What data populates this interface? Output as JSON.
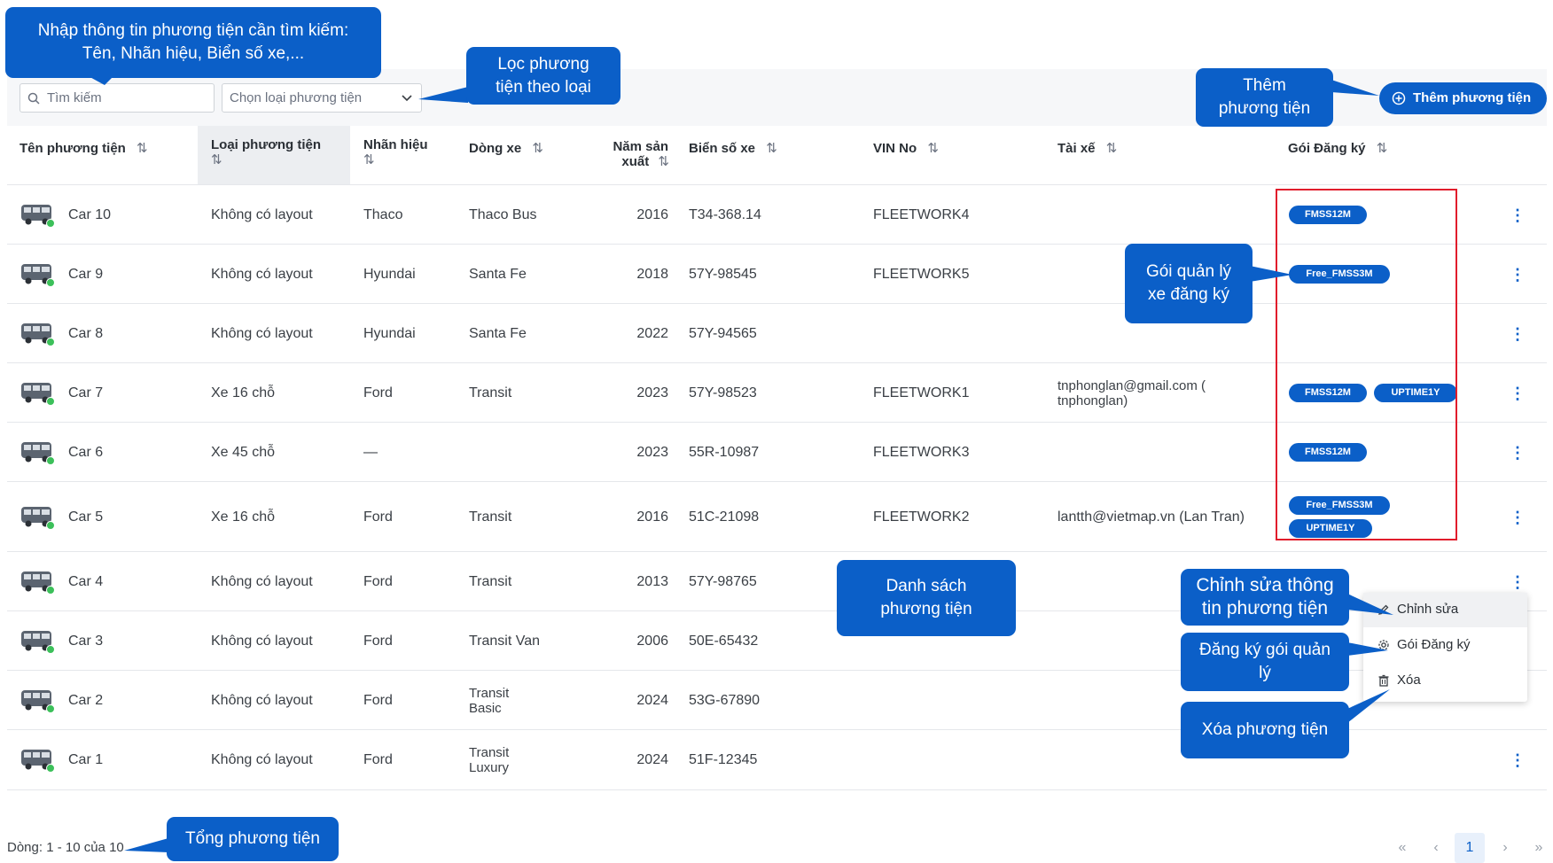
{
  "toolbar": {
    "search_placeholder": "Tìm kiếm",
    "type_select_placeholder": "Chọn loại phương tiện",
    "add_button_label": "Thêm phương tiện"
  },
  "columns": {
    "name": "Tên phương tiện",
    "type": "Loại phương tiện",
    "brand": "Nhãn hiệu",
    "model": "Dòng xe",
    "year_line1": "Năm sản",
    "year_line2": "xuất",
    "plate": "Biển số xe",
    "vin": "VIN No",
    "driver": "Tài xế",
    "package": "Gói Đăng ký",
    "sort_icon": "⇅"
  },
  "rows": [
    {
      "name": "Car 10",
      "type": "Không có layout",
      "brand": "Thaco",
      "model": "Thaco Bus",
      "year": "2016",
      "plate": "T34-368.14",
      "vin": "FLEETWORK4",
      "driver": "",
      "packages": [
        "FMSS12M"
      ]
    },
    {
      "name": "Car 9",
      "type": "Không có layout",
      "brand": "Hyundai",
      "model": "Santa Fe",
      "year": "2018",
      "plate": "57Y-98545",
      "vin": "FLEETWORK5",
      "driver": "",
      "packages": [
        "Free_FMSS3M"
      ]
    },
    {
      "name": "Car 8",
      "type": "Không có layout",
      "brand": "Hyundai",
      "model": "Santa Fe",
      "year": "2022",
      "plate": "57Y-94565",
      "vin": "",
      "driver": "",
      "packages": []
    },
    {
      "name": "Car 7",
      "type": "Xe 16 chỗ",
      "brand": "Ford",
      "model": "Transit",
      "year": "2023",
      "plate": "57Y-98523",
      "vin": "FLEETWORK1",
      "driver": "tnphonglan@gmail.com (",
      "driver2": "tnphonglan)",
      "packages": [
        "FMSS12M",
        "UPTIME1Y"
      ]
    },
    {
      "name": "Car 6",
      "type": "Xe 45 chỗ",
      "brand": "—",
      "model": "",
      "year": "2023",
      "plate": "55R-10987",
      "vin": "FLEETWORK3",
      "driver": "",
      "packages": [
        "FMSS12M"
      ]
    },
    {
      "name": "Car 5",
      "type": "Xe 16 chỗ",
      "brand": "Ford",
      "model": "Transit",
      "year": "2016",
      "plate": "51C-21098",
      "vin": "FLEETWORK2",
      "driver": "lantth@vietmap.vn (Lan Tran)",
      "packages": [
        "Free_FMSS3M",
        "UPTIME1Y"
      ]
    },
    {
      "name": "Car 4",
      "type": "Không có layout",
      "brand": "Ford",
      "model": "Transit",
      "year": "2013",
      "plate": "57Y-98765",
      "vin": "",
      "driver": "",
      "packages": []
    },
    {
      "name": "Car 3",
      "type": "Không có layout",
      "brand": "Ford",
      "model": "Transit Van",
      "year": "2006",
      "plate": "50E-65432",
      "vin": "",
      "driver": "",
      "packages": []
    },
    {
      "name": "Car 2",
      "type": "Không có layout",
      "brand": "Ford",
      "model": "Transit",
      "model2": "Basic",
      "year": "2024",
      "plate": "53G-67890",
      "vin": "",
      "driver": "",
      "packages": []
    },
    {
      "name": "Car 1",
      "type": "Không có layout",
      "brand": "Ford",
      "model": "Transit",
      "model2": "Luxury",
      "year": "2024",
      "plate": "51F-12345",
      "vin": "",
      "driver": "",
      "packages": []
    }
  ],
  "context_menu": {
    "edit": "Chỉnh sửa",
    "subscribe": "Gói Đăng ký",
    "delete": "Xóa"
  },
  "callouts": {
    "search": [
      "Nhập thông tin phương tiện cần tìm kiếm:",
      "Tên, Nhãn hiệu, Biển số xe,..."
    ],
    "filter": [
      "Lọc phương",
      "tiện theo loại"
    ],
    "add": [
      "Thêm",
      "phương tiện"
    ],
    "package": [
      "Gói quản lý",
      "xe đăng ký"
    ],
    "list": [
      "Danh sách",
      "phương tiện"
    ],
    "edit": [
      "Chỉnh sửa thông",
      "tin phương tiện"
    ],
    "subscribe": [
      "Đăng ký gói quản",
      "lý"
    ],
    "delete": [
      "Xóa phương tiện"
    ],
    "total": [
      "Tổng phương tiện"
    ]
  },
  "footer": {
    "count": "Dòng: 1 - 10 của 10",
    "first": "«",
    "prev": "‹",
    "page": "1",
    "next": "›",
    "last": "»"
  },
  "colors": {
    "accent": "#0b5fc8",
    "highlight_box": "#e11d2c",
    "status_online": "#3cc05a"
  }
}
